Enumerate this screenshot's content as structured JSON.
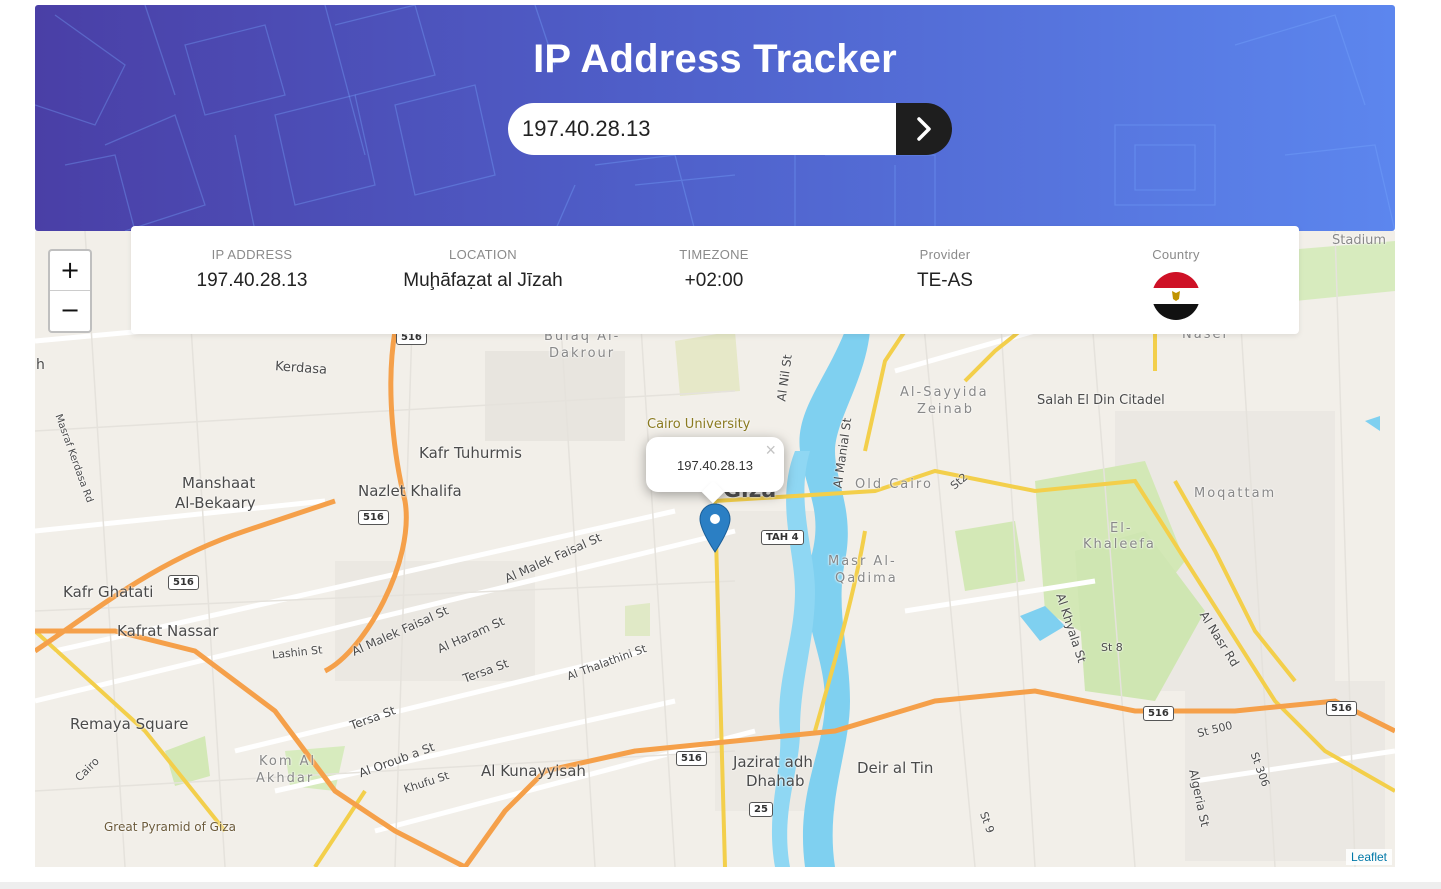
{
  "header": {
    "title": "IP Address Tracker",
    "search_value": "197.40.28.13",
    "search_button_icon": "chevron-right-icon"
  },
  "info": {
    "ip": {
      "label": "IP ADDRESS",
      "value": "197.40.28.13"
    },
    "location": {
      "label": "LOCATION",
      "value": "Muḩāfaẓat al Jīzah"
    },
    "timezone": {
      "label": "TIMEZONE",
      "value": "+02:00"
    },
    "provider": {
      "label": "Provider",
      "value": "TE-AS"
    },
    "country": {
      "label": "Country",
      "flag": "egypt-flag-icon"
    }
  },
  "map": {
    "zoom_in": "+",
    "zoom_out": "−",
    "popup_text": "197.40.28.13",
    "popup_close": "×",
    "attribution": "Leaflet",
    "labels": [
      "Kerdasa",
      "Bulaq Al-",
      "Dakrour",
      "Cairo University",
      "Kafr Tuhurmis",
      "Nazlet Khalifa",
      "Manshaat",
      "Al-Bekaary",
      "Kafr Ghatati",
      "Kafrat Nassar",
      "Remaya Square",
      "Kom Al",
      "Akhdar",
      "Great Pyramid of Giza",
      "Al Kunayyisah",
      "Jazirat adh",
      "Dhahab",
      "Deir al Tin",
      "Masr Al-",
      "Qadima",
      "Old Cairo",
      "Al-Sayyida",
      "Zeinab",
      "Salah El Din Citadel",
      "Moqattam",
      "El-",
      "Khaleefa",
      "Naser",
      "Stadium",
      "Al Malek Faisal St",
      "Al Malek Faisal St",
      "Al Haram St",
      "Tersa St",
      "Tersa St",
      "Lashin St",
      "Al Oroub a St",
      "Khufu St",
      "Al Thalathini St",
      "Al Nil St",
      "Al Manial St",
      "Al Khyala St",
      "Al Nasr Rd",
      "St 8",
      "St 500",
      "St 306",
      "Algeria St",
      "St 9",
      "St2",
      "Cairo",
      "Masraf Kerdasa Rd",
      "Giza",
      "h",
      "St 9"
    ],
    "shields": [
      "516",
      "516",
      "516",
      "516",
      "516",
      "516",
      "TAH 4",
      "25",
      "516"
    ]
  },
  "colors": {
    "header_gradient_start": "#4a3fa6",
    "header_gradient_end": "#5c86ee",
    "river": "#7fd0f0",
    "major_road": "#f5a04a",
    "secondary_road": "#f3cf4b",
    "park": "#cfe6b2",
    "marker": "#2b7fc4"
  }
}
